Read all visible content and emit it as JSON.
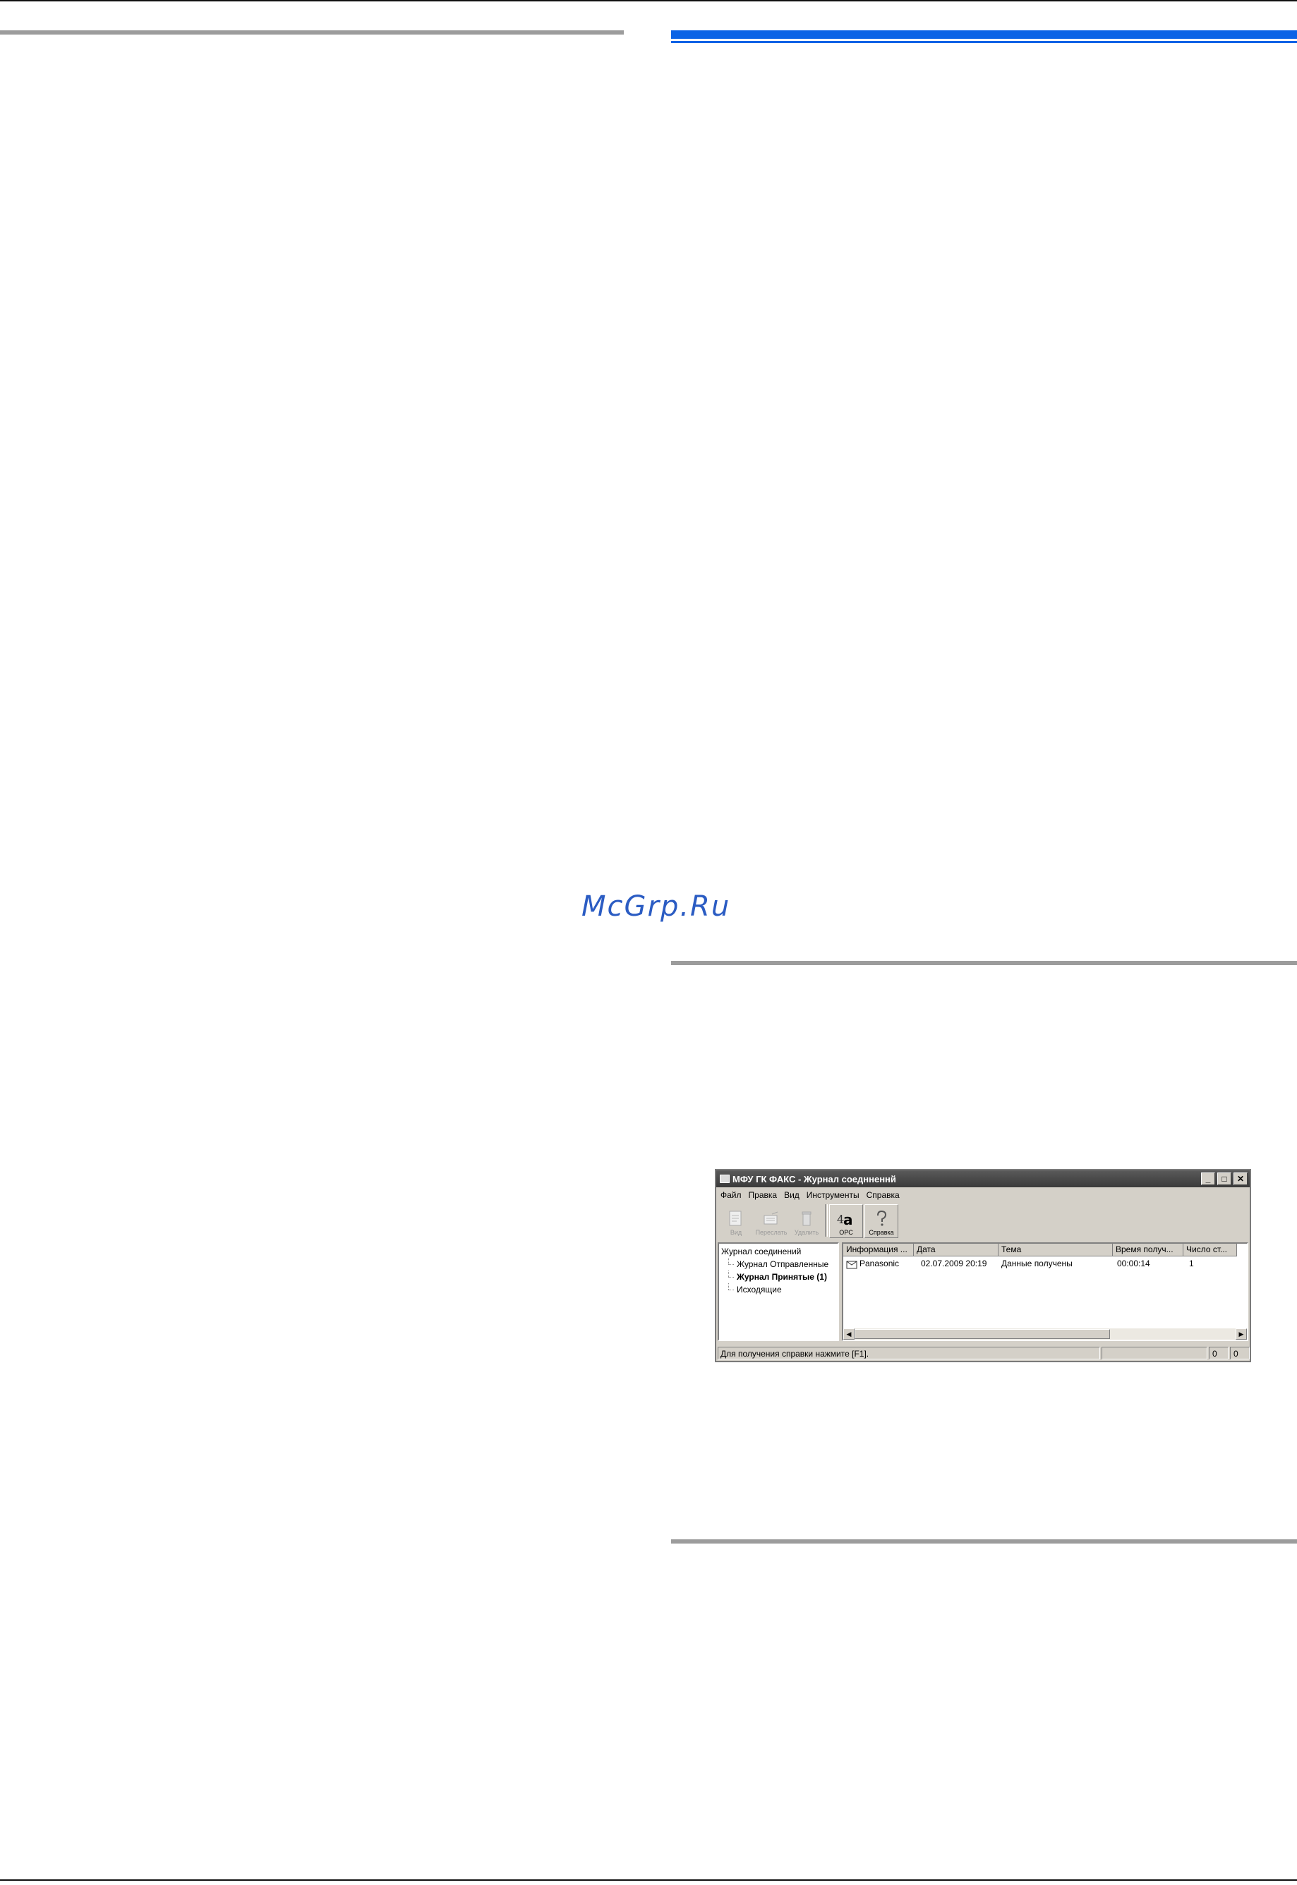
{
  "watermark": "McGrp.Ru",
  "window": {
    "title": "МФУ ГК ФАКС - Журнал соеднненнй",
    "menu": [
      "Файл",
      "Правка",
      "Вид",
      "Инструменты",
      "Справка"
    ],
    "toolbar": {
      "view": "Вид",
      "forward": "Переслать",
      "delete": "Удалить",
      "ocr": "OPC",
      "help": "Справка"
    },
    "tree": {
      "root": "Журнал соединений",
      "sent": "Журнал Отправленные",
      "received": "Журнал Принятые (1)",
      "outgoing": "Исходящие"
    },
    "list": {
      "columns": [
        "Информация ...",
        "Дата",
        "Тема",
        "Время получ...",
        "Число ст..."
      ],
      "row": [
        "Panasonic",
        "02.07.2009 20:19",
        "Данные получены",
        "00:00:14",
        "1"
      ]
    },
    "status": {
      "text": "Для получения справки нажмите [F1].",
      "count1": "0",
      "count2": "0"
    }
  }
}
